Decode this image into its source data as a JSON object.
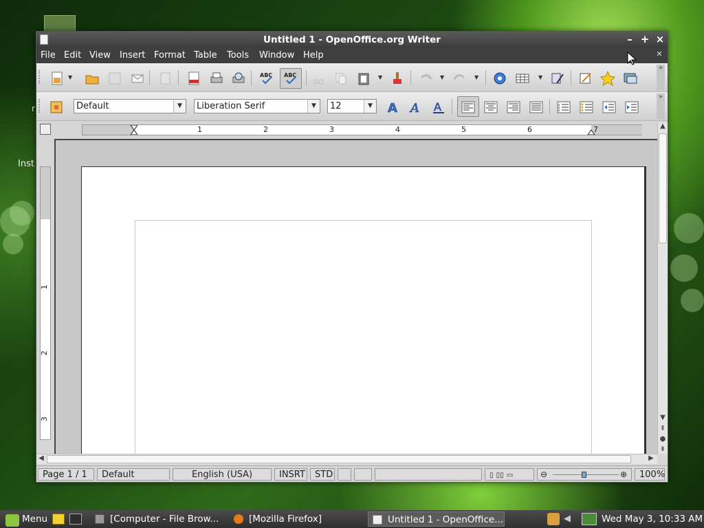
{
  "desktop": {
    "partial_label": "Inst",
    "partial_label2": "r"
  },
  "window": {
    "title": "Untitled 1 - OpenOffice.org Writer"
  },
  "menubar": {
    "items": [
      "File",
      "Edit",
      "View",
      "Insert",
      "Format",
      "Table",
      "Tools",
      "Window",
      "Help"
    ]
  },
  "formatting": {
    "style": "Default",
    "font": "Liberation Serif",
    "size": "12"
  },
  "ruler": {
    "numbers": [
      "1",
      "2",
      "3",
      "4",
      "5",
      "6",
      "7"
    ],
    "vnumbers": [
      "1",
      "2",
      "3"
    ]
  },
  "statusbar": {
    "page": "Page 1 / 1",
    "style": "Default",
    "language": "English (USA)",
    "insert_mode": "INSRT",
    "selection_mode": "STD",
    "zoom": "100%"
  },
  "taskbar": {
    "menu_label": "Menu",
    "tasks": [
      "[Computer - File Brow...",
      "[Mozilla Firefox]",
      "Untitled 1 - OpenOffice..."
    ],
    "clock": "Wed May  3, 10:33 AM"
  }
}
